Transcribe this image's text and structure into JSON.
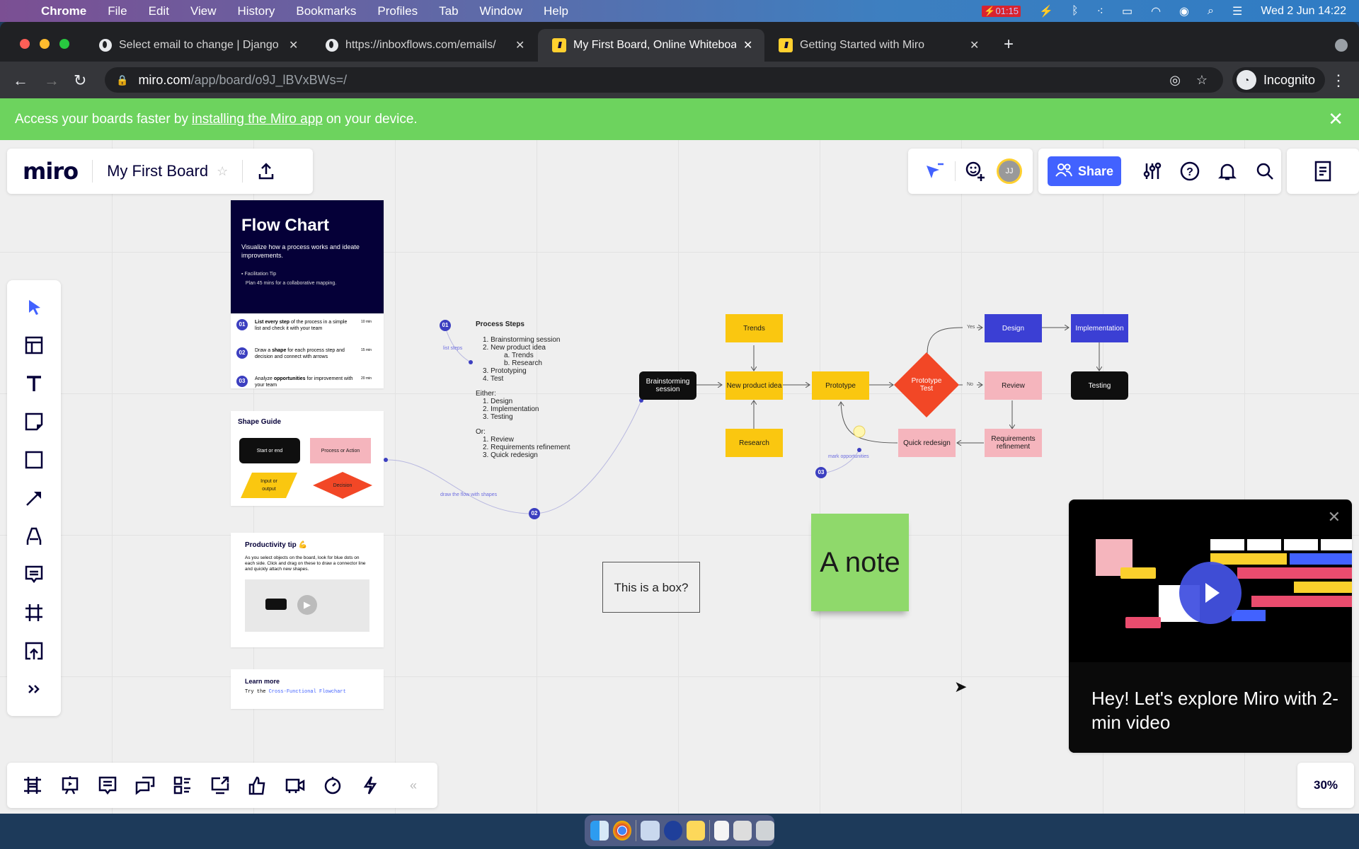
{
  "menubar": {
    "app": "Chrome",
    "items": [
      "File",
      "Edit",
      "View",
      "History",
      "Bookmarks",
      "Profiles",
      "Tab",
      "Window",
      "Help"
    ],
    "recording_time": "01:15",
    "datetime": "Wed 2 Jun  14:22"
  },
  "browser": {
    "tabs": [
      {
        "title": "Select email to change | Django",
        "icon": "globe-icon"
      },
      {
        "title": "https://inboxflows.com/emails/",
        "icon": "globe-icon"
      },
      {
        "title": "My First Board, Online Whiteboard",
        "icon": "miro-icon",
        "active": true
      },
      {
        "title": "Getting Started with Miro",
        "icon": "miro-icon"
      }
    ],
    "url_host": "miro.com",
    "url_path": "/app/board/o9J_lBVxBWs=/",
    "profile": "Incognito"
  },
  "banner": {
    "prefix": "Access your boards faster by",
    "link": "installing the Miro app",
    "suffix": "on your device."
  },
  "board": {
    "logo": "miro",
    "name": "My First Board",
    "share_label": "Share",
    "avatar_initials": "JJ",
    "zoom": "30%",
    "accent": "#4262ff"
  },
  "left_tools": [
    "select",
    "templates",
    "text",
    "sticky-note",
    "shape",
    "connection-line",
    "pen",
    "comment",
    "frame",
    "upload",
    "more"
  ],
  "bottom_tools": [
    "frames",
    "presentation",
    "comments",
    "screen-share",
    "card",
    "share-screen",
    "voting",
    "video-chat",
    "timer",
    "lightning"
  ],
  "flowchart_card": {
    "title": "Flow Chart",
    "subtitle": "Visualize how a process works and ideate improvements.",
    "tip_label": "Facilitation Tip",
    "tip_text": "Plan 45 mins for a collaborative mapping.",
    "steps": [
      {
        "num": "01",
        "bold": "List every step",
        "text": " of the process in a simple list and check it with your team",
        "duration": "10 min"
      },
      {
        "num": "02",
        "pre": "Draw a ",
        "bold": "shape",
        "text": " for each process step and decision and connect with arrows",
        "duration": "15 min"
      },
      {
        "num": "03",
        "pre": "Analyze ",
        "bold": "opportunities",
        "text": " for improvement with your team",
        "duration": "20 min"
      }
    ]
  },
  "shape_guide": {
    "title": "Shape Guide",
    "shapes": [
      "Start or end",
      "Process or Action",
      "Input or output",
      "Decision"
    ]
  },
  "productivity_tip": {
    "title": "Productivity tip 💪",
    "text": "As you select objects on the board, look for blue dots on each side. Click and drag on these to draw a connector line and quickly attach new shapes."
  },
  "learn_more": {
    "title": "Learn more",
    "prefix": "Try the",
    "link": "Cross-Functional Flowchart"
  },
  "process_steps": {
    "title": "Process Steps",
    "lines": [
      "1. Brainstorming session",
      "2. New product idea",
      "a. Trends",
      "b. Research",
      "3. Prototyping",
      "4. Test",
      "Either:",
      "1. Design",
      "2. Implementation",
      "3. Testing",
      "Or:",
      "1. Review",
      "2. Requirements refinement",
      "3. Quick redesign"
    ]
  },
  "annotations": {
    "a1": "list steps",
    "a2": "draw the flow with shapes",
    "a3": "mark opportunities",
    "n1": "01",
    "n2": "02",
    "n3": "03"
  },
  "flow": {
    "brainstorm": "Brainstorming session",
    "trends": "Trends",
    "idea": "New product idea",
    "research": "Research",
    "prototype": "Prototype",
    "test": "Prototype Test",
    "design": "Design",
    "implementation": "Implementation",
    "testing": "Testing",
    "review": "Review",
    "refinement": "Requirements refinement",
    "redesign": "Quick redesign",
    "yes": "Yes",
    "no": "No"
  },
  "box_text": "This is a box?",
  "note_text": "A note",
  "video_popup": {
    "caption": "Hey! Let's explore Miro with 2-min video"
  }
}
